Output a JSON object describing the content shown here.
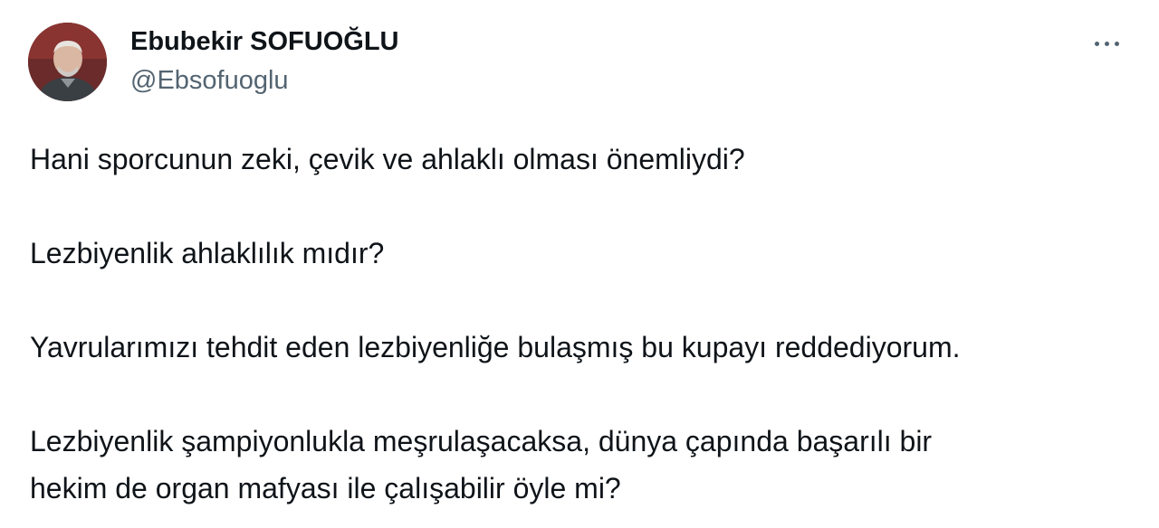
{
  "author": {
    "display_name": "Ebubekir SOFUOĞLU",
    "handle": "@Ebsofuoglu",
    "avatar_icon": "profile-photo"
  },
  "more_icon": "more-options-icon",
  "tweet": {
    "paragraphs": [
      "Hani sporcunun zeki, çevik ve ahlaklı olması önemliydi?",
      "Lezbiyenlik ahlaklılık mıdır?",
      "Yavrularımızı tehdit eden lezbiyenliğe bulaşmış bu kupayı reddediyorum.",
      "Lezbiyenlik şampiyonlukla meşrulaşacaksa, dünya çapında başarılı bir",
      "hekim de organ mafyası ile çalışabilir öyle mi?"
    ]
  },
  "colors": {
    "text_primary": "#0f1419",
    "text_secondary": "#536471",
    "background": "#ffffff"
  }
}
